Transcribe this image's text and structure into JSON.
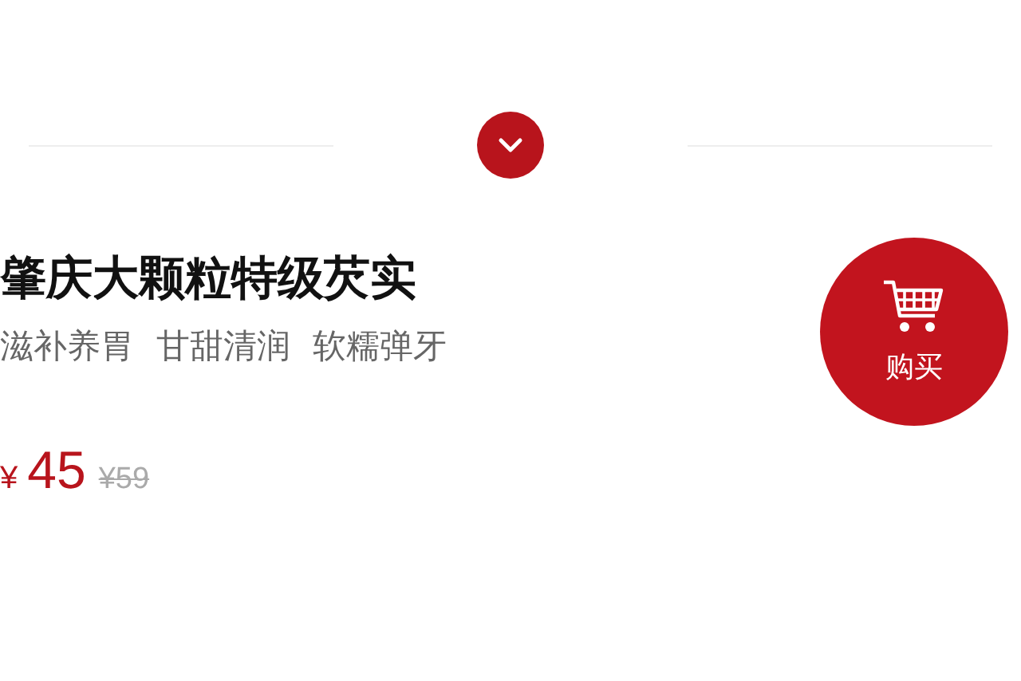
{
  "title": "肇庆大颗粒特级芡实",
  "tags": [
    "滋补养胃",
    "甘甜清润",
    "软糯弹牙"
  ],
  "price": {
    "currency": "¥",
    "amount": "45",
    "original": "¥59"
  },
  "buy_button": {
    "label": "购买"
  }
}
